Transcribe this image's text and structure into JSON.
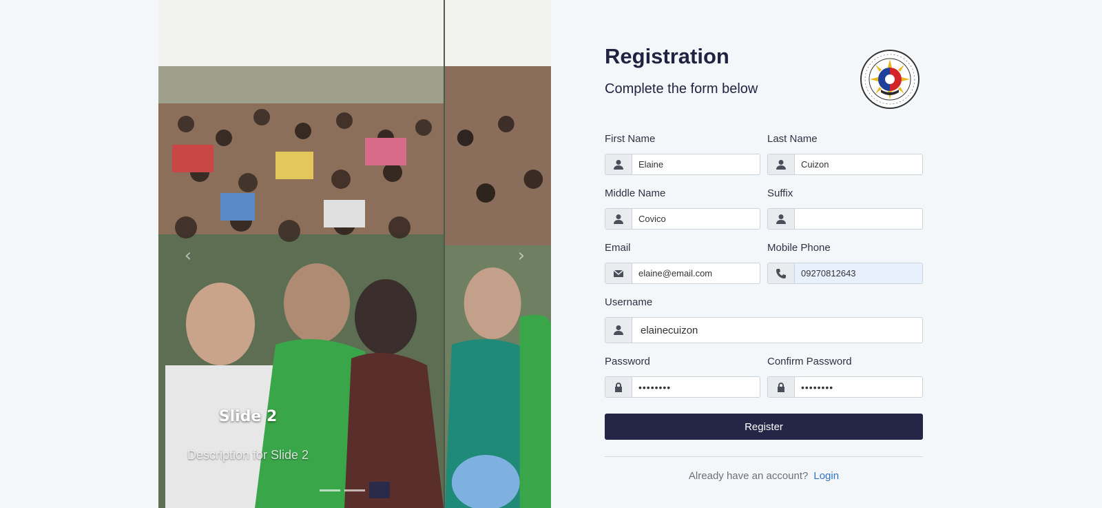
{
  "carousel": {
    "caption_title": "Slide 2",
    "caption_description": "Description for Slide 2",
    "prev_glyph": "‹",
    "next_glyph": "›",
    "slide_count": 3,
    "active_slide": 2
  },
  "form": {
    "title": "Registration",
    "subtitle": "Complete the form below",
    "fields": {
      "first_name": {
        "label": "First Name",
        "value": "Elaine",
        "icon": "user-icon"
      },
      "last_name": {
        "label": "Last Name",
        "value": "Cuizon",
        "icon": "user-icon"
      },
      "middle_name": {
        "label": "Middle Name",
        "value": "Covico",
        "icon": "user-icon"
      },
      "suffix": {
        "label": "Suffix",
        "value": "",
        "icon": "user-icon"
      },
      "email": {
        "label": "Email",
        "value": "elaine@email.com",
        "icon": "envelope-icon"
      },
      "mobile_phone": {
        "label": "Mobile Phone",
        "value": "09270812643",
        "icon": "phone-icon"
      },
      "username": {
        "label": "Username",
        "value": "elainecuizon",
        "icon": "user-icon"
      },
      "password": {
        "label": "Password",
        "value": "••••••••",
        "icon": "lock-icon"
      },
      "confirm_password": {
        "label": "Confirm Password",
        "value": "••••••••",
        "icon": "lock-icon"
      }
    },
    "register_label": "Register",
    "login_prompt": "Already have an account?",
    "login_link": "Login"
  },
  "colors": {
    "background": "#f4f7fa",
    "primary_dark": "#232646",
    "link": "#2f73c9",
    "autofill": "#e8f0fe"
  }
}
